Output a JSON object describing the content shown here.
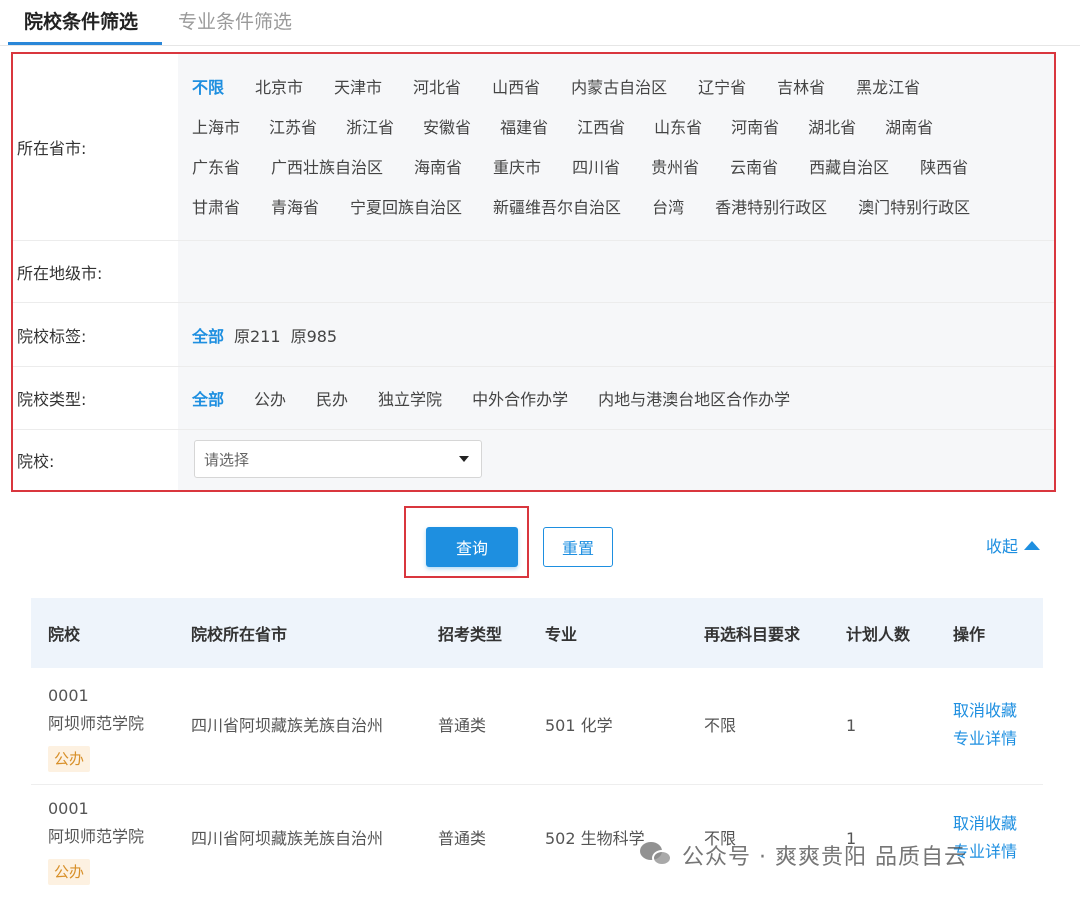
{
  "tabs": {
    "active": "院校条件筛选",
    "inactive": "专业条件筛选"
  },
  "filters": {
    "province_label": "所在省市:",
    "provinces": [
      "不限",
      "北京市",
      "天津市",
      "河北省",
      "山西省",
      "内蒙古自治区",
      "辽宁省",
      "吉林省",
      "黑龙江省",
      "上海市",
      "江苏省",
      "浙江省",
      "安徽省",
      "福建省",
      "江西省",
      "山东省",
      "河南省",
      "湖北省",
      "湖南省",
      "广东省",
      "广西壮族自治区",
      "海南省",
      "重庆市",
      "四川省",
      "贵州省",
      "云南省",
      "西藏自治区",
      "陕西省",
      "甘肃省",
      "青海省",
      "宁夏回族自治区",
      "新疆维吾尔自治区",
      "台湾",
      "香港特别行政区",
      "澳门特别行政区"
    ],
    "province_selected": "不限",
    "city_label": "所在地级市:",
    "tag_label": "院校标签:",
    "tags": [
      "全部",
      "原211",
      "原985"
    ],
    "tag_selected": "全部",
    "type_label": "院校类型:",
    "types": [
      "全部",
      "公办",
      "民办",
      "独立学院",
      "中外合作办学",
      "内地与港澳台地区合作办学"
    ],
    "type_selected": "全部",
    "school_label": "院校:",
    "school_select": "请选择"
  },
  "actions": {
    "query": "查询",
    "reset": "重置",
    "collapse": "收起"
  },
  "table": {
    "headers": [
      "院校",
      "院校所在省市",
      "招考类型",
      "专业",
      "再选科目要求",
      "计划人数",
      "操作"
    ],
    "rows": [
      {
        "code": "0001",
        "school": "阿坝师范学院",
        "tag": "公办",
        "location": "四川省阿坝藏族羌族自治州",
        "type": "普通类",
        "major": "501 化学",
        "requirement": "不限",
        "count": "1",
        "action1": "取消收藏",
        "action2": "专业详情"
      },
      {
        "code": "0001",
        "school": "阿坝师范学院",
        "tag": "公办",
        "location": "四川省阿坝藏族羌族自治州",
        "type": "普通类",
        "major": "502 生物科学",
        "requirement": "不限",
        "count": "1",
        "action1": "取消收藏",
        "action2": "专业详情"
      }
    ]
  },
  "watermark": "公众号 · 爽爽贵阳 品质自云"
}
